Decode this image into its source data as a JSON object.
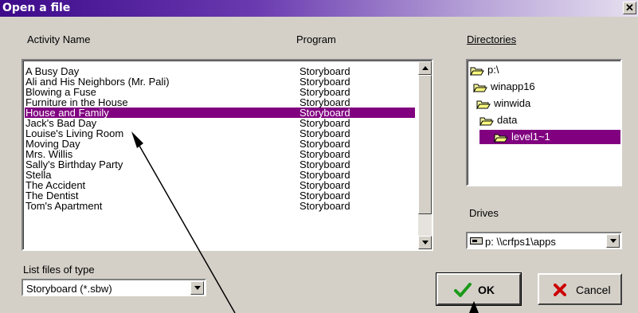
{
  "window": {
    "title": "Open a file",
    "close_glyph": "✕"
  },
  "headers": {
    "activity": "Activity Name",
    "program": "Program",
    "directories": "Directories"
  },
  "files": [
    {
      "name": "A Busy Day",
      "program": "Storyboard"
    },
    {
      "name": "Ali and His Neighbors (Mr. Pali)",
      "program": "Storyboard"
    },
    {
      "name": "Blowing a Fuse",
      "program": "Storyboard"
    },
    {
      "name": "Furniture in the House",
      "program": "Storyboard"
    },
    {
      "name": "House and Family",
      "program": "Storyboard"
    },
    {
      "name": "Jack's Bad Day",
      "program": "Storyboard"
    },
    {
      "name": "Louise's Living Room",
      "program": "Storyboard"
    },
    {
      "name": "Moving Day",
      "program": "Storyboard"
    },
    {
      "name": "Mrs. Willis",
      "program": "Storyboard"
    },
    {
      "name": "Sally's Birthday Party",
      "program": "Storyboard"
    },
    {
      "name": "Stella",
      "program": "Storyboard"
    },
    {
      "name": "The Accident",
      "program": "Storyboard"
    },
    {
      "name": "The Dentist",
      "program": "Storyboard"
    },
    {
      "name": "Tom's Apartment",
      "program": "Storyboard"
    }
  ],
  "selected_file_index": 4,
  "directories": [
    {
      "name": "p:\\",
      "icon": "open-folder-icon"
    },
    {
      "name": "winapp16",
      "icon": "open-folder-icon"
    },
    {
      "name": "winwida",
      "icon": "open-folder-icon"
    },
    {
      "name": "data",
      "icon": "open-folder-icon"
    },
    {
      "name": "level1~1",
      "icon": "open-folder-icon"
    }
  ],
  "selected_dir_index": 4,
  "drives": {
    "label": "Drives",
    "value": "p: \\\\crfps1\\apps",
    "icon": "network-drive-icon"
  },
  "file_type": {
    "label": "List files of type",
    "value": "Storyboard (*.sbw)"
  },
  "buttons": {
    "ok": "OK",
    "cancel": "Cancel"
  },
  "colors": {
    "selection": "#800080",
    "ok_check": "#1a9a1a",
    "cancel_x": "#cc0000",
    "title_start": "#3d0a8a"
  }
}
